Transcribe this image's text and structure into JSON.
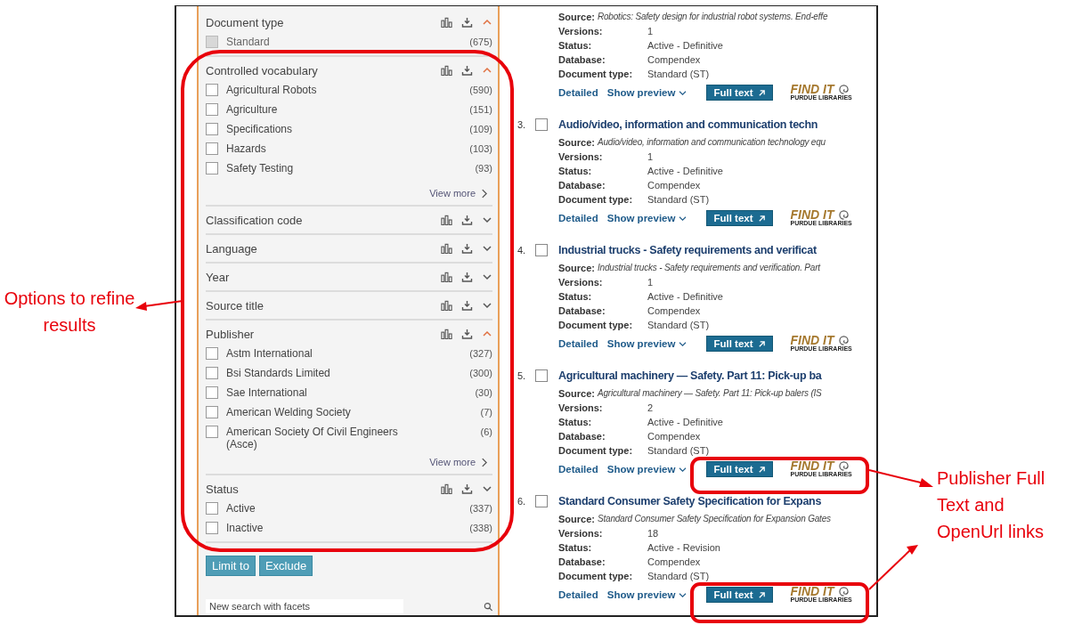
{
  "facets": [
    {
      "title": "Document type",
      "expanded": true,
      "items": [
        {
          "label": "Standard",
          "count": "(675)",
          "checked": false,
          "disabled": true
        }
      ]
    },
    {
      "title": "Controlled vocabulary",
      "expanded": true,
      "items": [
        {
          "label": "Agricultural Robots",
          "count": "(590)",
          "checked": false,
          "disabled": false
        },
        {
          "label": "Agriculture",
          "count": "(151)",
          "checked": false,
          "disabled": false
        },
        {
          "label": "Specifications",
          "count": "(109)",
          "checked": false,
          "disabled": false
        },
        {
          "label": "Hazards",
          "count": "(103)",
          "checked": false,
          "disabled": false
        },
        {
          "label": "Safety Testing",
          "count": "(93)",
          "checked": false,
          "disabled": false
        }
      ],
      "more": "View more"
    },
    {
      "title": "Classification code",
      "expanded": false
    },
    {
      "title": "Language",
      "expanded": false
    },
    {
      "title": "Year",
      "expanded": false
    },
    {
      "title": "Source title",
      "expanded": false
    },
    {
      "title": "Publisher",
      "expanded": true,
      "items": [
        {
          "label": "Astm International",
          "count": "(327)",
          "checked": false,
          "disabled": false
        },
        {
          "label": "Bsi Standards Limited",
          "count": "(300)",
          "checked": false,
          "disabled": false
        },
        {
          "label": "Sae International",
          "count": "(30)",
          "checked": false,
          "disabled": false
        },
        {
          "label": "American Welding Society",
          "count": "(7)",
          "checked": false,
          "disabled": false
        },
        {
          "label": "American Society Of Civil Engineers (Asce)",
          "count": "(6)",
          "checked": false,
          "disabled": false
        }
      ],
      "more": "View more"
    },
    {
      "title": "Status",
      "expanded": false,
      "items": [
        {
          "label": "Active",
          "count": "(337)",
          "checked": false,
          "disabled": false
        },
        {
          "label": "Inactive",
          "count": "(338)",
          "checked": false,
          "disabled": false
        }
      ]
    }
  ],
  "facet_buttons": [
    "Limit to",
    "Exclude"
  ],
  "facet_search": {
    "placeholder": "New search with facets"
  },
  "results": [
    {
      "source_label": "Source:",
      "source": "Robotics: Safety design for industrial robot systems. End-effe",
      "fields": [
        {
          "label": "Versions:",
          "value": "1"
        },
        {
          "label": "Status:",
          "value": "Active - Definitive"
        },
        {
          "label": "Database:",
          "value": "Compendex"
        },
        {
          "label": "Document type:",
          "value": "Standard (ST)"
        }
      ],
      "detailed": "Detailed",
      "preview": "Show preview",
      "full_text": "Full text",
      "logo_top": "FIND IT",
      "logo_bottom": "PURDUE LIBRARIES"
    },
    {
      "number": "3.",
      "checked": false,
      "title": "Audio/video, information and communication techn",
      "source_label": "Source:",
      "source": "Audio/video, information and communication technology equ",
      "fields": [
        {
          "label": "Versions:",
          "value": "1"
        },
        {
          "label": "Status:",
          "value": "Active - Definitive"
        },
        {
          "label": "Database:",
          "value": "Compendex"
        },
        {
          "label": "Document type:",
          "value": "Standard (ST)"
        }
      ],
      "detailed": "Detailed",
      "preview": "Show preview",
      "full_text": "Full text",
      "logo_top": "FIND IT",
      "logo_bottom": "PURDUE LIBRARIES"
    },
    {
      "number": "4.",
      "checked": false,
      "title": "Industrial trucks - Safety requirements and verificat",
      "source_label": "Source:",
      "source": "Industrial trucks - Safety requirements and verification. Part",
      "fields": [
        {
          "label": "Versions:",
          "value": "1"
        },
        {
          "label": "Status:",
          "value": "Active - Definitive"
        },
        {
          "label": "Database:",
          "value": "Compendex"
        },
        {
          "label": "Document type:",
          "value": "Standard (ST)"
        }
      ],
      "detailed": "Detailed",
      "preview": "Show preview",
      "full_text": "Full text",
      "logo_top": "FIND IT",
      "logo_bottom": "PURDUE LIBRARIES"
    },
    {
      "number": "5.",
      "checked": false,
      "title": "Agricultural machinery — Safety. Part 11: Pick-up ba",
      "source_label": "Source:",
      "source": "Agricultural machinery — Safety. Part 11: Pick-up balers (IS",
      "fields": [
        {
          "label": "Versions:",
          "value": "2"
        },
        {
          "label": "Status:",
          "value": "Active - Definitive"
        },
        {
          "label": "Database:",
          "value": "Compendex"
        },
        {
          "label": "Document type:",
          "value": "Standard (ST)"
        }
      ],
      "detailed": "Detailed",
      "preview": "Show preview",
      "full_text": "Full text",
      "logo_top": "FIND IT",
      "logo_bottom": "PURDUE LIBRARIES"
    },
    {
      "number": "6.",
      "checked": false,
      "title": "Standard Consumer Safety Specification for Expans",
      "source_label": "Source:",
      "source": "Standard Consumer Safety Specification for Expansion Gates",
      "fields": [
        {
          "label": "Versions:",
          "value": "18"
        },
        {
          "label": "Status:",
          "value": "Active - Revision"
        },
        {
          "label": "Database:",
          "value": "Compendex"
        },
        {
          "label": "Document type:",
          "value": "Standard (ST)"
        }
      ],
      "detailed": "Detailed",
      "preview": "Show preview",
      "full_text": "Full text",
      "logo_top": "FIND IT",
      "logo_bottom": "PURDUE LIBRARIES"
    }
  ],
  "callouts": [
    {
      "text": "Options to refine results"
    },
    {
      "text": "Publisher Full Text and OpenUrl links"
    }
  ]
}
